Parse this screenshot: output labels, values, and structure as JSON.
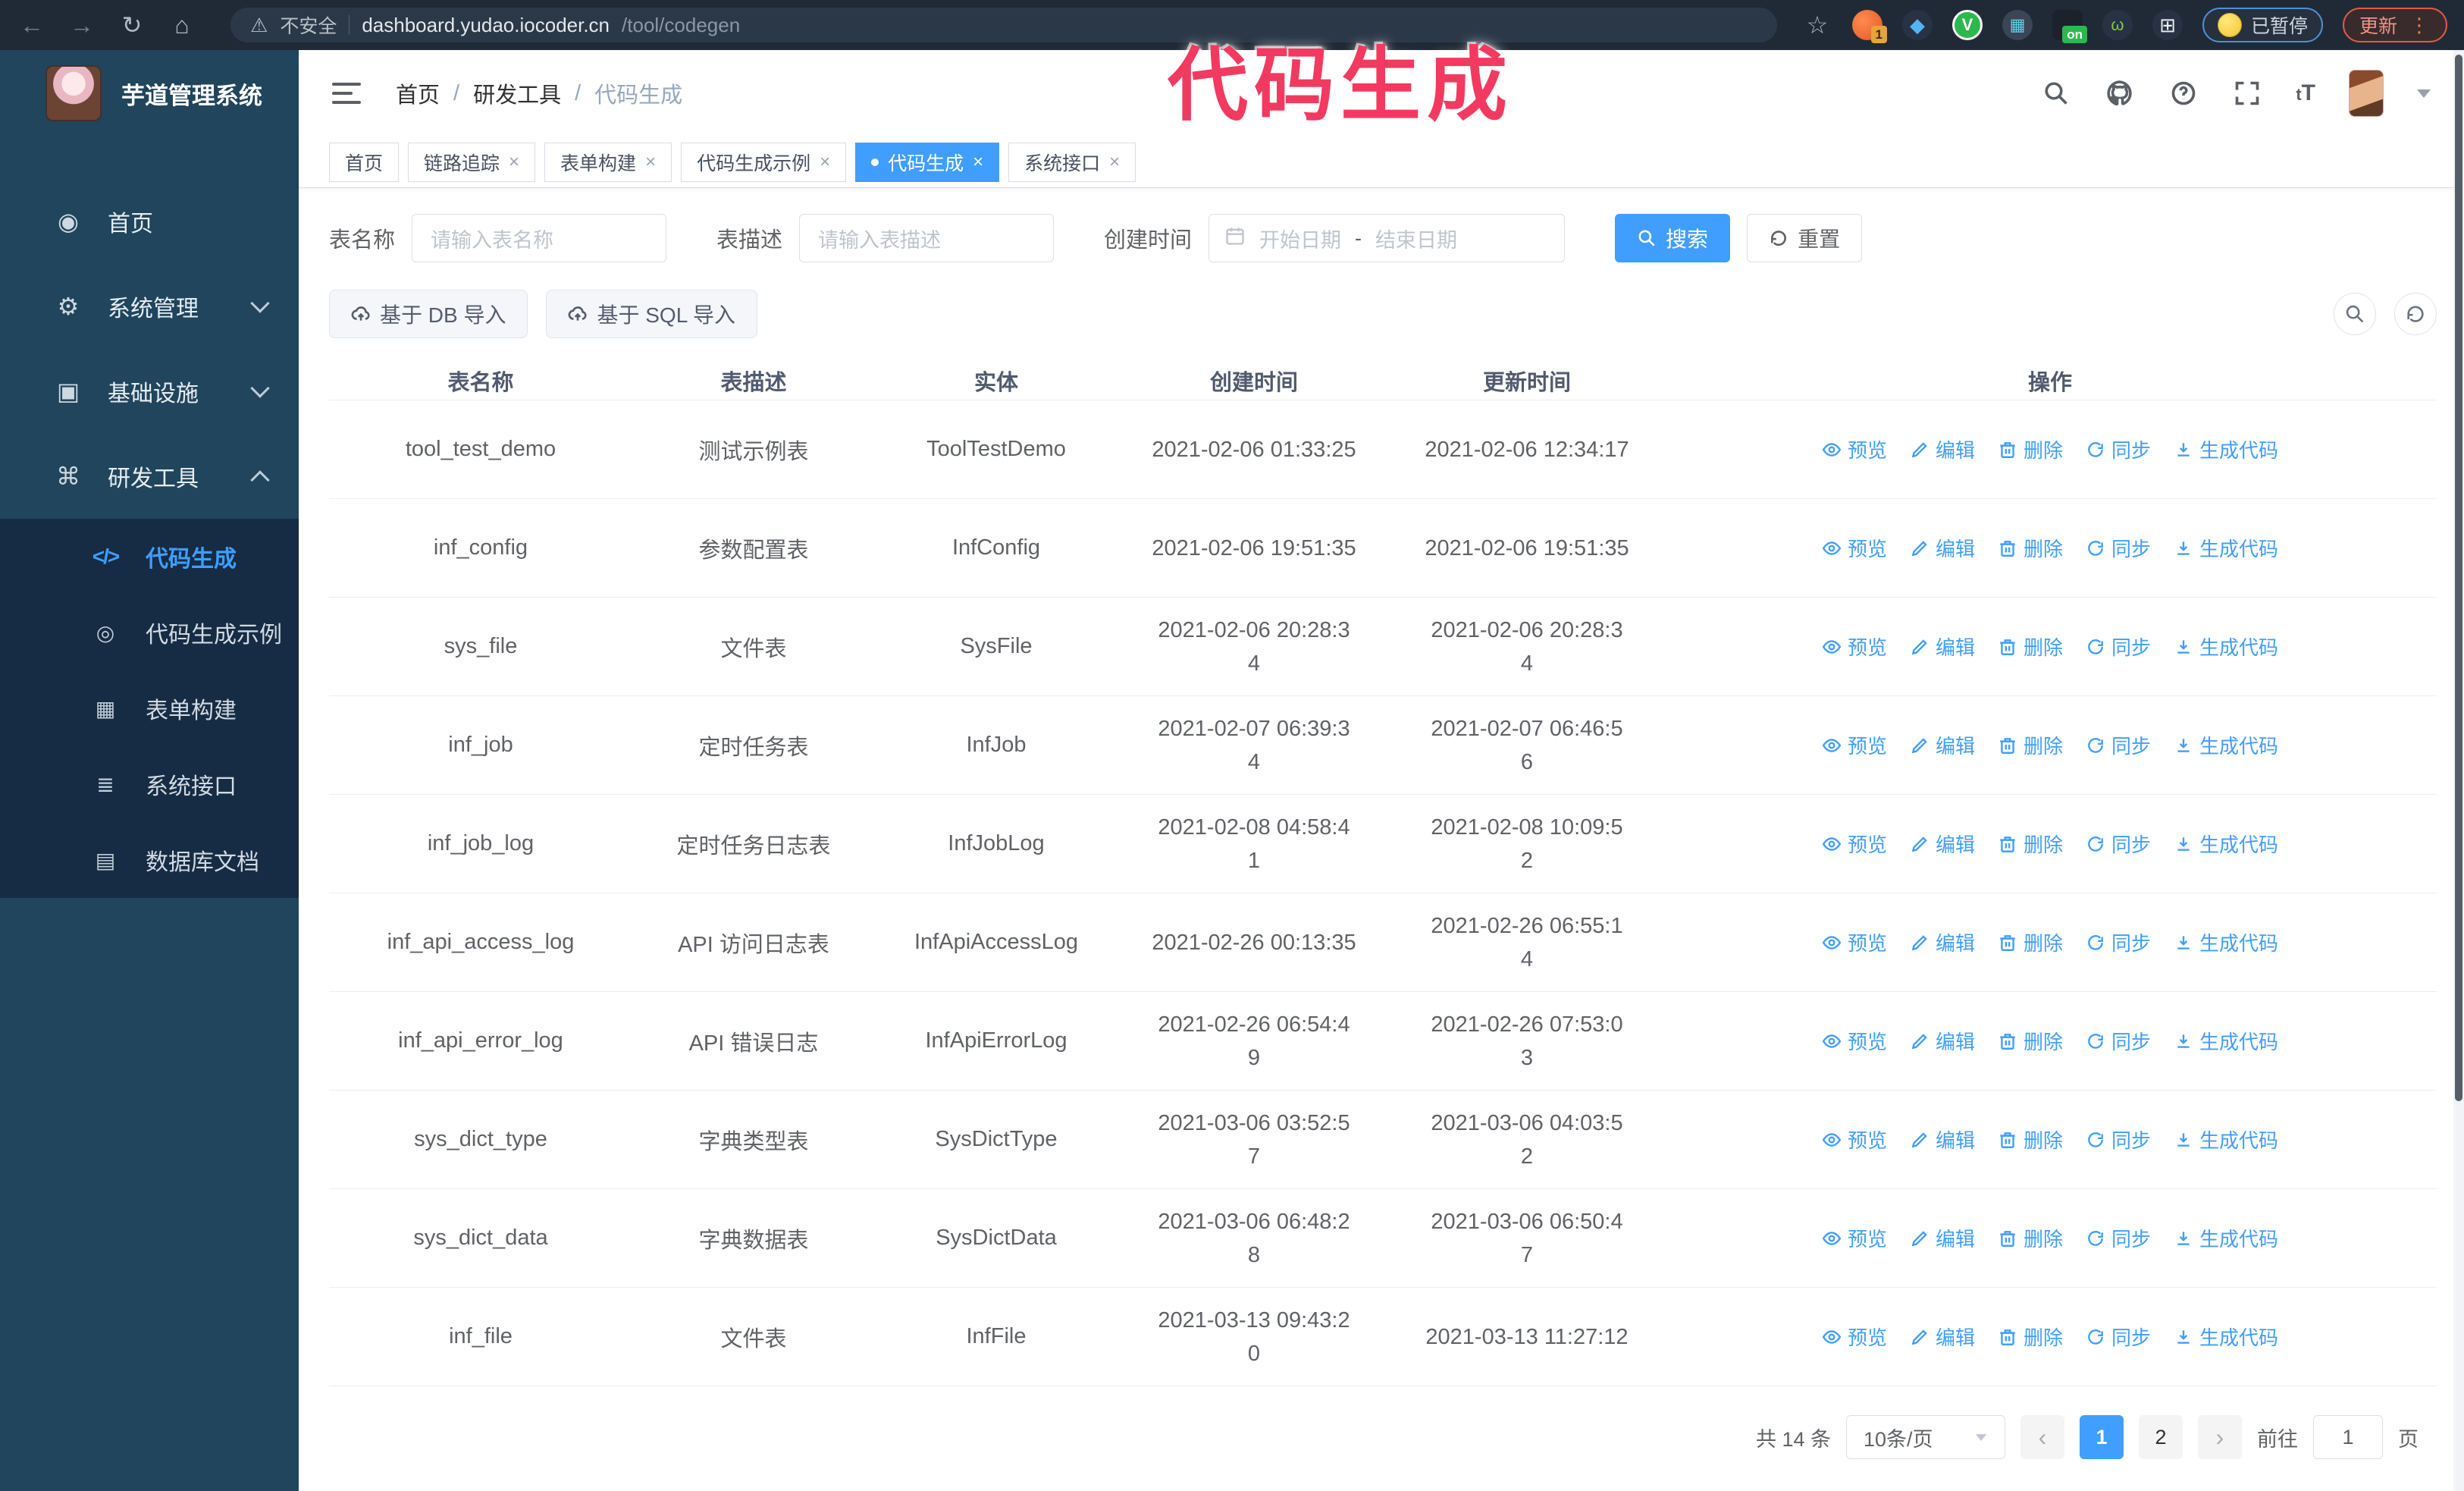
{
  "browser": {
    "security_label": "不安全",
    "url_host": "dashboard.yudao.iocoder.cn",
    "url_path": "/tool/codegen",
    "extensions": [
      "orange-extension",
      "gem-extension",
      "green-check-extension",
      "grid-extension",
      "dark-on-extension",
      "monkey-extension",
      "puzzle-extension"
    ],
    "ext_badge_1": "1",
    "ext_badge_on": "on",
    "paused_badge": "已暂停",
    "update_button": "更新",
    "update_dots": "⋮"
  },
  "watermark": "代码生成",
  "header": {
    "app_title": "芋道管理系统",
    "breadcrumb": {
      "home": "首页",
      "group": "研发工具",
      "current": "代码生成",
      "separator": "/"
    },
    "font_size_icon": "tT"
  },
  "sidebar": {
    "menu": [
      {
        "label": "首页",
        "expandable": false
      },
      {
        "label": "系统管理",
        "expandable": true,
        "state": "collapsed"
      },
      {
        "label": "基础设施",
        "expandable": true,
        "state": "collapsed"
      },
      {
        "label": "研发工具",
        "expandable": true,
        "state": "expanded"
      }
    ],
    "submenu": [
      {
        "label": "代码生成",
        "active": true,
        "icon_glyph": "</>"
      },
      {
        "label": "代码生成示例",
        "active": false,
        "icon_glyph": "◎"
      },
      {
        "label": "表单构建",
        "active": false,
        "icon_glyph": "▦"
      },
      {
        "label": "系统接口",
        "active": false,
        "icon_glyph": "≣"
      },
      {
        "label": "数据库文档",
        "active": false,
        "icon_glyph": "▤"
      }
    ]
  },
  "tabs": [
    {
      "label": "首页"
    },
    {
      "label": "链路追踪"
    },
    {
      "label": "表单构建"
    },
    {
      "label": "代码生成示例"
    },
    {
      "label": "代码生成"
    },
    {
      "label": "系统接口"
    }
  ],
  "search": {
    "name_label": "表名称",
    "name_placeholder": "请输入表名称",
    "desc_label": "表描述",
    "desc_placeholder": "请输入表描述",
    "time_label": "创建时间",
    "start_placeholder": "开始日期",
    "range_separator": "-",
    "end_placeholder": "结束日期",
    "search_label": "搜索",
    "reset_label": "重置"
  },
  "toolbar": {
    "import_db_label": "基于 DB 导入",
    "import_sql_label": "基于 SQL 导入"
  },
  "table": {
    "columns": [
      "表名称",
      "表描述",
      "实体",
      "创建时间",
      "更新时间",
      "操作"
    ],
    "actions": [
      "预览",
      "编辑",
      "删除",
      "同步",
      "生成代码"
    ],
    "rows": [
      {
        "name": "tool_test_demo",
        "desc": "测试示例表",
        "entity": "ToolTestDemo",
        "created": "2021-02-06 01:33:25",
        "updated": "2021-02-06 12:34:17"
      },
      {
        "name": "inf_config",
        "desc": "参数配置表",
        "entity": "InfConfig",
        "created": "2021-02-06 19:51:35",
        "updated": "2021-02-06 19:51:35"
      },
      {
        "name": "sys_file",
        "desc": "文件表",
        "entity": "SysFile",
        "created": "2021-02-06 20:28:3\n4",
        "updated": "2021-02-06 20:28:3\n4"
      },
      {
        "name": "inf_job",
        "desc": "定时任务表",
        "entity": "InfJob",
        "created": "2021-02-07 06:39:3\n4",
        "updated": "2021-02-07 06:46:5\n6"
      },
      {
        "name": "inf_job_log",
        "desc": "定时任务日志表",
        "entity": "InfJobLog",
        "created": "2021-02-08 04:58:4\n1",
        "updated": "2021-02-08 10:09:5\n2"
      },
      {
        "name": "inf_api_access_log",
        "desc": "API 访问日志表",
        "entity": "InfApiAccessLog",
        "created": "2021-02-26 00:13:35",
        "updated": "2021-02-26 06:55:1\n4"
      },
      {
        "name": "inf_api_error_log",
        "desc": "API 错误日志",
        "entity": "InfApiErrorLog",
        "created": "2021-02-26 06:54:4\n9",
        "updated": "2021-02-26 07:53:0\n3"
      },
      {
        "name": "sys_dict_type",
        "desc": "字典类型表",
        "entity": "SysDictType",
        "created": "2021-03-06 03:52:5\n7",
        "updated": "2021-03-06 04:03:5\n2"
      },
      {
        "name": "sys_dict_data",
        "desc": "字典数据表",
        "entity": "SysDictData",
        "created": "2021-03-06 06:48:2\n8",
        "updated": "2021-03-06 06:50:4\n7"
      },
      {
        "name": "inf_file",
        "desc": "文件表",
        "entity": "InfFile",
        "created": "2021-03-13 09:43:2\n0",
        "updated": "2021-03-13 11:27:12"
      }
    ]
  },
  "pagination": {
    "total": "共 14 条",
    "page_size": "10条/页",
    "prev": "‹",
    "next": "›",
    "page1": "1",
    "page2": "2",
    "active_page": "1",
    "goto_label": "前往",
    "goto_value": "1",
    "page_unit": "页"
  },
  "colors": {
    "accent": "#409eff",
    "sidebar_bg": "#20455d",
    "submenu_bg": "#152c44",
    "browser_bar_bg": "#202a36",
    "watermark_pink": "#f23a60",
    "update_border": "#dd5a4b",
    "paused_border": "#4f8fd6"
  }
}
